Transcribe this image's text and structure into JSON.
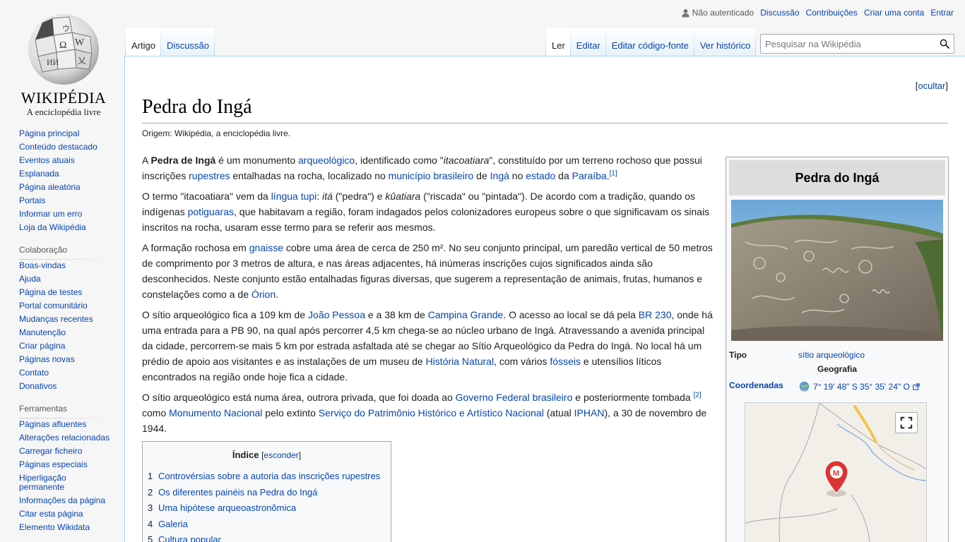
{
  "logo": {
    "wordmark": "WIKIPÉDIA",
    "tagline": "A enciclopédia livre"
  },
  "personal": {
    "not_logged_in": "Não autenticado",
    "talk": "Discussão",
    "contributions": "Contribuições",
    "create_account": "Criar uma conta",
    "login": "Entrar"
  },
  "tabs": {
    "left": [
      "Artigo",
      "Discussão"
    ],
    "right": [
      "Ler",
      "Editar",
      "Editar código-fonte",
      "Ver histórico"
    ]
  },
  "search": {
    "placeholder": "Pesquisar na Wikipédia"
  },
  "sidebar": {
    "navigation": [
      "Página principal",
      "Conteúdo destacado",
      "Eventos atuais",
      "Esplanada",
      "Página aleatória",
      "Portais",
      "Informar um erro",
      "Loja da Wikipédia"
    ],
    "collab_title": "Colaboração",
    "collab": [
      "Boas-vindas",
      "Ajuda",
      "Página de testes",
      "Portal comunitário",
      "Mudanças recentes",
      "Manutenção",
      "Criar página",
      "Páginas novas",
      "Contato",
      "Donativos"
    ],
    "tools_title": "Ferramentas",
    "tools": [
      "Páginas afluentes",
      "Alterações relacionadas",
      "Carregar ficheiro",
      "Páginas especiais",
      "Hiperligação permanente",
      "Informações da página",
      "Citar esta página",
      "Elemento Wikidata"
    ]
  },
  "article": {
    "hide_label": "ocultar",
    "title": "Pedra do Ingá",
    "site_sub": "Origem: Wikipédia, a enciclopédia livre.",
    "p1": {
      "a": "A ",
      "bold": "Pedra de Ingá",
      "b": " é um monumento ",
      "l1": "arqueológico",
      "c": ", identificado como \"",
      "it": "itacoatiara",
      "d": "\", constituído por um terreno rochoso que possui inscrições ",
      "l2": "rupestres",
      "e": " entalhadas na rocha, localizado no ",
      "l3": "município brasileiro",
      "f": " de ",
      "l4": "Ingá",
      "g": " no ",
      "l5": "estado",
      "h": " da ",
      "l6": "Paraíba",
      "i": ".",
      "ref": "[1]"
    },
    "p2": {
      "a": "O termo \"itacoatiara\" vem da ",
      "l1": "língua tupi",
      "b": ": ",
      "it1": "itá",
      "c": " (\"pedra\") e ",
      "it2": "kûatiara",
      "d": " (\"riscada\" ou \"pintada\"). De acordo com a tradição, quando os indígenas ",
      "l2": "potiguaras",
      "e": ", que habitavam a região, foram indagados pelos colonizadores europeus sobre o que significavam os sinais inscritos na rocha, usaram esse termo para se referir aos mesmos."
    },
    "p3": {
      "a": "A formação rochosa em ",
      "l1": "gnaisse",
      "b": " cobre uma área de cerca de 250 m². No seu conjunto principal, um paredão vertical de 50 metros de comprimento por 3 metros de altura, e nas áreas adjacentes, há inúmeras inscrições cujos significados ainda são desconhecidos. Neste conjunto estão entalhadas figuras diversas, que sugerem a representação de animais, frutas, humanos e constelações como a de ",
      "l2": "Órion",
      "c": "."
    },
    "p4": {
      "a": "O sítio arqueológico fica a 109 km de ",
      "l1": "João Pessoa",
      "b": " e a 38 km de ",
      "l2": "Campina Grande",
      "c": ". O acesso ao local se dá pela ",
      "l3": "BR 230",
      "d": ", onde há uma entrada para a PB 90, na qual após percorrer 4,5 km chega-se ao núcleo urbano de Ingá. Atravessando a avenida principal da cidade, percorrem-se mais 5 km por estrada asfaltada até se chegar ao Sítio Arqueológico da Pedra do Ingá. No local há um prédio de apoio aos visitantes e as instalações de um museu de ",
      "l4": "História Natural",
      "e": ", com vários ",
      "l5": "fósseis",
      "f": " e utensílios líticos encontrados na região onde hoje fica a cidade."
    },
    "p5": {
      "a": "O sítio arqueológico está numa área, outrora privada, que foi doada ao ",
      "l1": "Governo Federal brasileiro",
      "b": " e posteriormente tombada ",
      "ref": "[2]",
      "c": " como ",
      "l2": "Monumento Nacional",
      "d": " pelo extinto ",
      "l3": "Serviço do Patrimônio Histórico e Artístico Nacional",
      "e": " (atual ",
      "l4": "IPHAN",
      "f": "), a 30 de novembro de 1944."
    }
  },
  "toc": {
    "title": "Índice",
    "hide": "esconder",
    "items": [
      {
        "num": "1",
        "label": "Controvérsias sobre a autoria das inscrições rupestres"
      },
      {
        "num": "2",
        "label": "Os diferentes painéis na Pedra do Ingá"
      },
      {
        "num": "3",
        "label": "Uma hipótese arqueoastronômica"
      },
      {
        "num": "4",
        "label": "Galeria"
      },
      {
        "num": "5",
        "label": "Cultura popular"
      }
    ]
  },
  "infobox": {
    "title": "Pedra do Ingá",
    "tipo_label": "Tipo",
    "tipo_value": "sítio arqueológico",
    "geo_header": "Geografia",
    "coord_label": "Coordenadas",
    "coord_value": "7° 19' 48\" S 35° 35' 24\" O"
  }
}
